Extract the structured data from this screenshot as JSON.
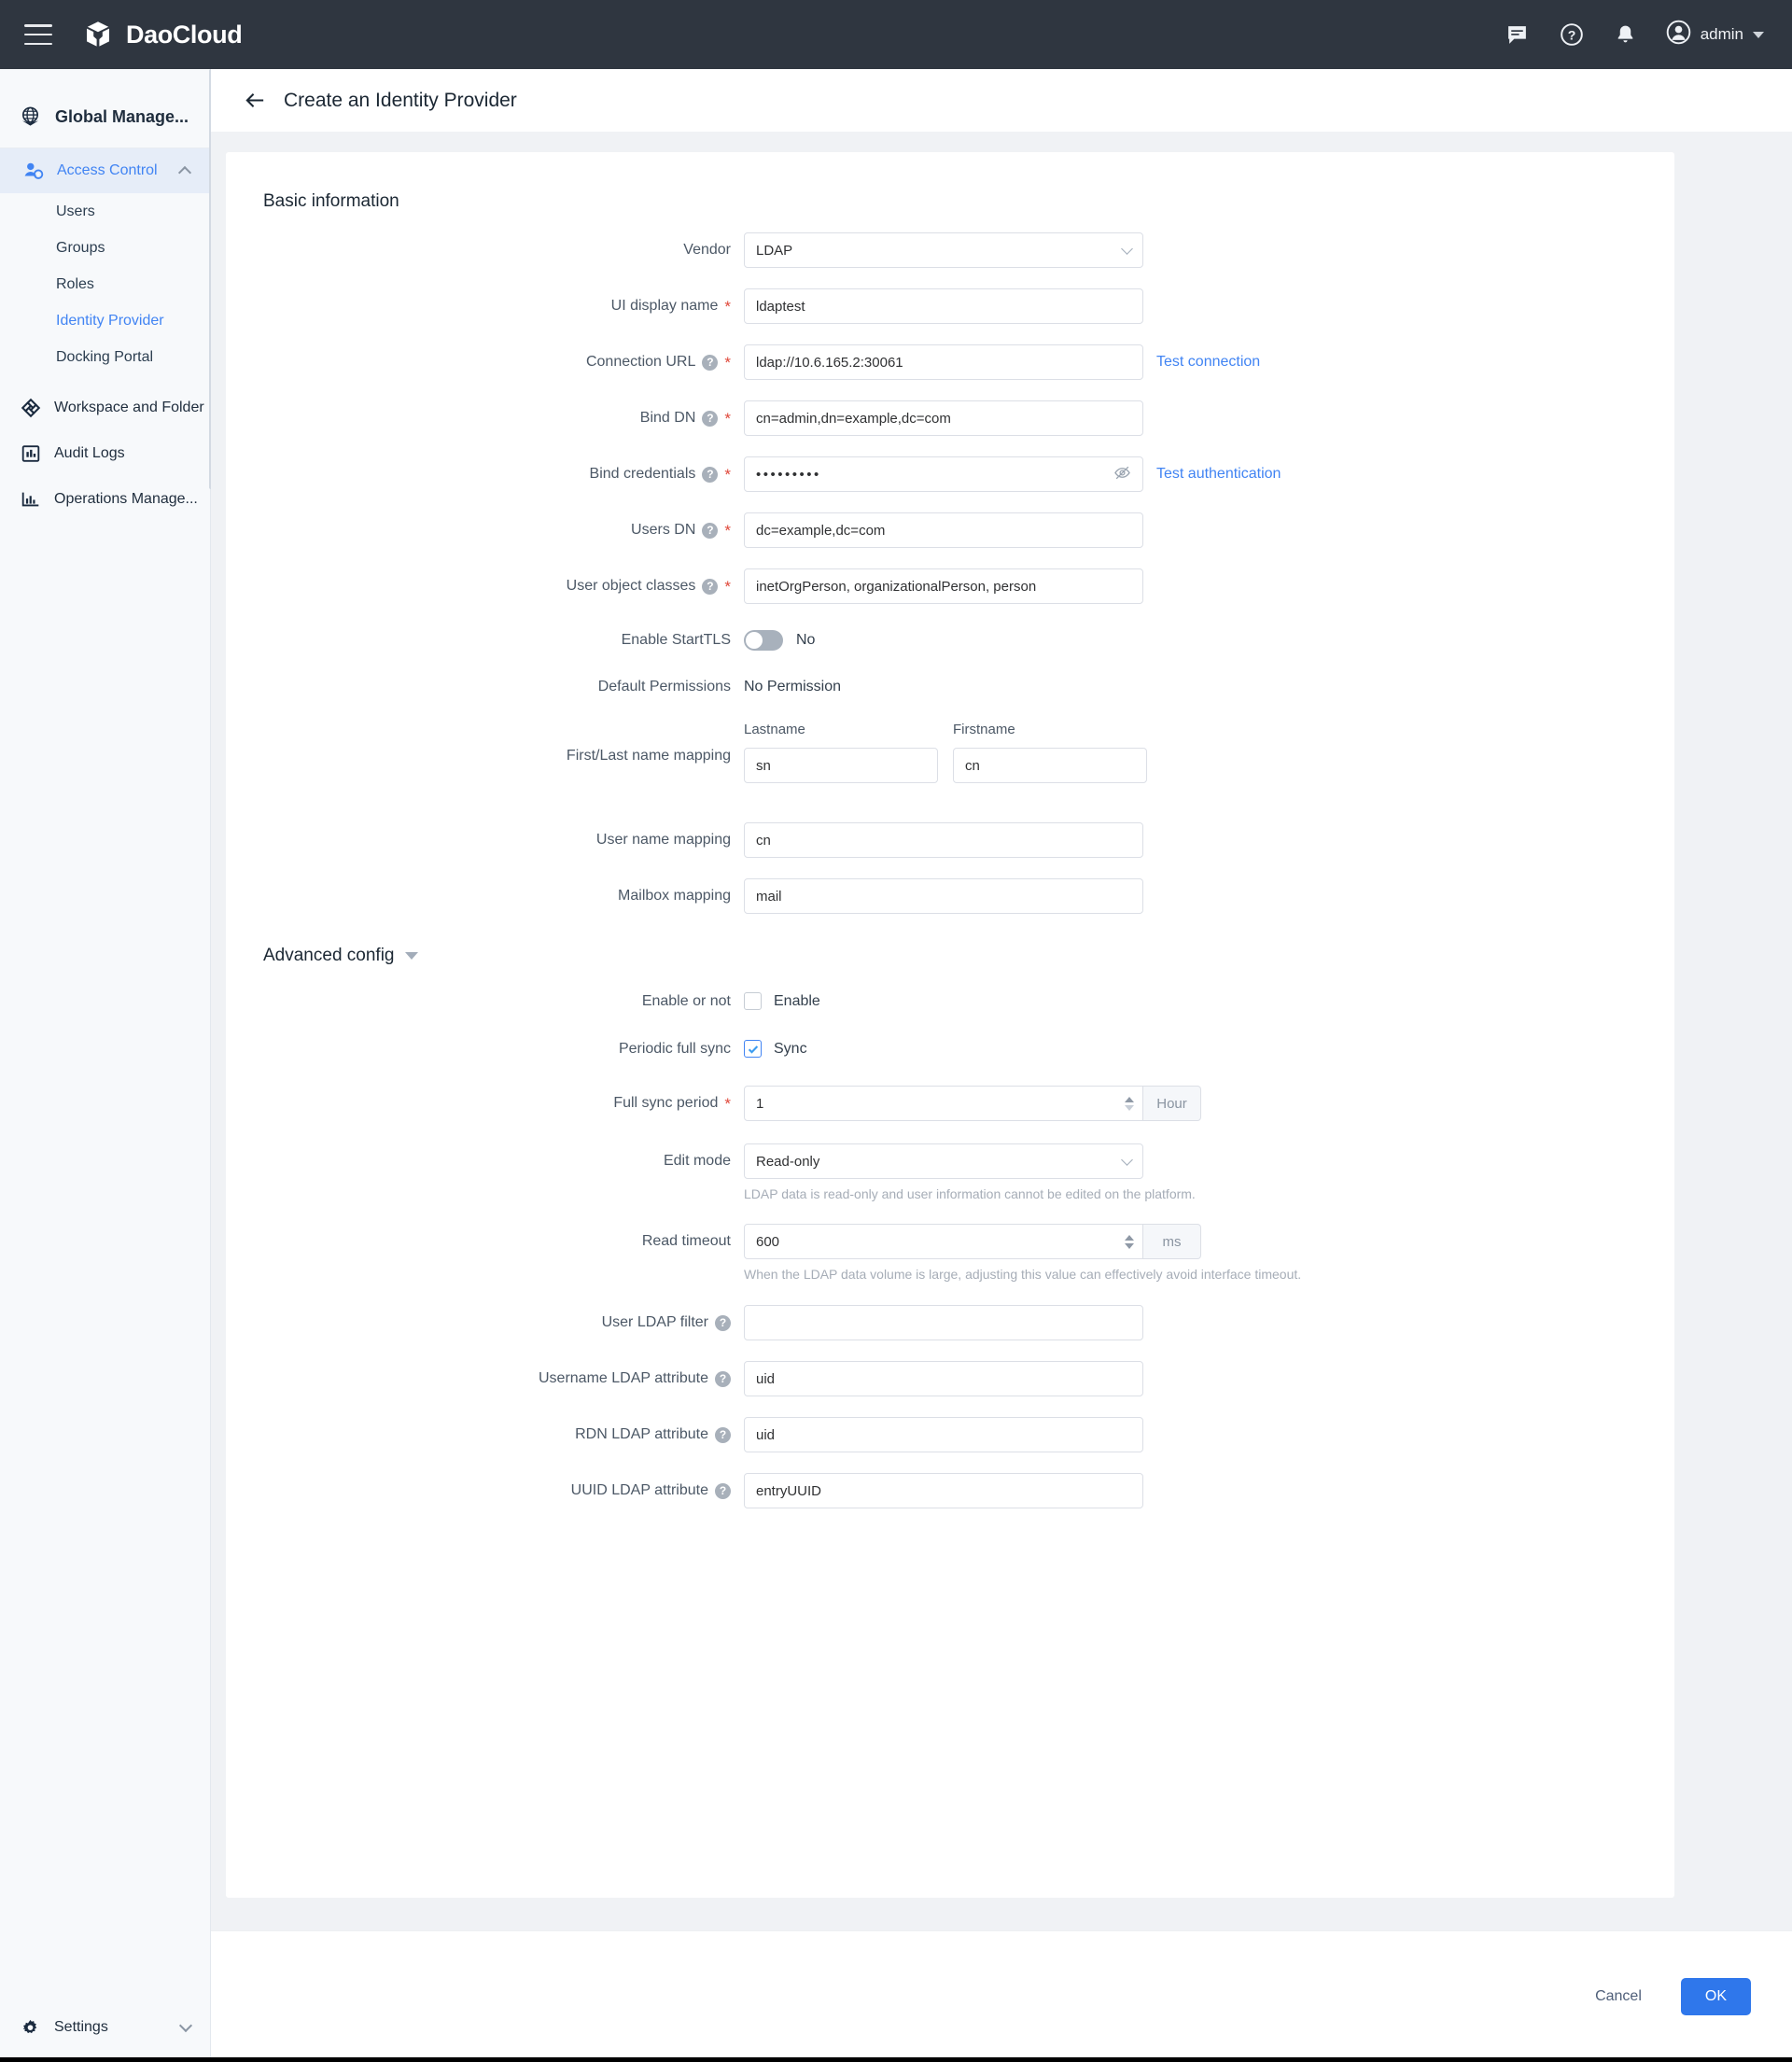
{
  "topbar": {
    "brand": "DaoCloud",
    "menu_icon": "hamburger-icon",
    "icons": [
      "chat-icon",
      "help-icon",
      "bell-icon"
    ],
    "user": "admin"
  },
  "sidebar": {
    "workspace_title": "Global Manage...",
    "group": {
      "label": "Access Control",
      "items": [
        {
          "label": "Users",
          "active": false
        },
        {
          "label": "Groups",
          "active": false
        },
        {
          "label": "Roles",
          "active": false
        },
        {
          "label": "Identity Provider",
          "active": true
        },
        {
          "label": "Docking Portal",
          "active": false
        }
      ]
    },
    "items": [
      {
        "label": "Workspace and Folder",
        "icon": "workspace-icon"
      },
      {
        "label": "Audit Logs",
        "icon": "audit-icon"
      },
      {
        "label": "Operations Manage...",
        "icon": "operations-icon"
      }
    ],
    "footer": {
      "label": "Settings",
      "icon": "gear-icon"
    }
  },
  "page": {
    "title": "Create an Identity Provider",
    "back_icon": "back-arrow-icon"
  },
  "basic": {
    "section_title": "Basic information",
    "vendor": {
      "label": "Vendor",
      "value": "LDAP"
    },
    "ui_display_name": {
      "label": "UI display name",
      "value": "ldaptest"
    },
    "connection_url": {
      "label": "Connection URL",
      "value": "ldap://10.6.165.2:30061",
      "action": "Test connection"
    },
    "bind_dn": {
      "label": "Bind DN",
      "value": "cn=admin,dn=example,dc=com"
    },
    "bind_credentials": {
      "label": "Bind credentials",
      "value": "•••••••••",
      "action": "Test authentication"
    },
    "users_dn": {
      "label": "Users DN",
      "value": "dc=example,dc=com"
    },
    "user_object_classes": {
      "label": "User object classes",
      "value": "inetOrgPerson, organizationalPerson, person"
    },
    "enable_starttls": {
      "label": "Enable StartTLS",
      "state": "No"
    },
    "default_permissions": {
      "label": "Default Permissions",
      "value": "No Permission"
    },
    "name_mapping": {
      "label": "First/Last name mapping",
      "lastname_head": "Lastname",
      "lastname_value": "sn",
      "firstname_head": "Firstname",
      "firstname_value": "cn"
    },
    "user_name_mapping": {
      "label": "User name mapping",
      "value": "cn"
    },
    "mailbox_mapping": {
      "label": "Mailbox mapping",
      "value": "mail"
    }
  },
  "advanced": {
    "section_title": "Advanced config",
    "enable_or_not": {
      "label": "Enable or not",
      "checkbox_label": "Enable",
      "checked": false
    },
    "periodic_full_sync": {
      "label": "Periodic full sync",
      "checkbox_label": "Sync",
      "checked": true
    },
    "full_sync_period": {
      "label": "Full sync period",
      "value": "1",
      "unit": "Hour"
    },
    "edit_mode": {
      "label": "Edit mode",
      "value": "Read-only",
      "hint": "LDAP data is read-only and user information cannot be edited on the platform."
    },
    "read_timeout": {
      "label": "Read timeout",
      "value": "600",
      "unit": "ms",
      "hint": "When the LDAP data volume is large, adjusting this value can effectively avoid interface timeout."
    },
    "user_ldap_filter": {
      "label": "User LDAP filter",
      "value": ""
    },
    "username_ldap_attribute": {
      "label": "Username LDAP attribute",
      "value": "uid"
    },
    "rdn_ldap_attribute": {
      "label": "RDN LDAP attribute",
      "value": "uid"
    },
    "uuid_ldap_attribute": {
      "label": "UUID LDAP attribute",
      "value": "entryUUID"
    }
  },
  "footer": {
    "cancel": "Cancel",
    "ok": "OK"
  },
  "colors": {
    "accent": "#4184f3",
    "primary_button": "#2f77eb",
    "topbar": "#2f3640",
    "required": "#e0483a"
  }
}
